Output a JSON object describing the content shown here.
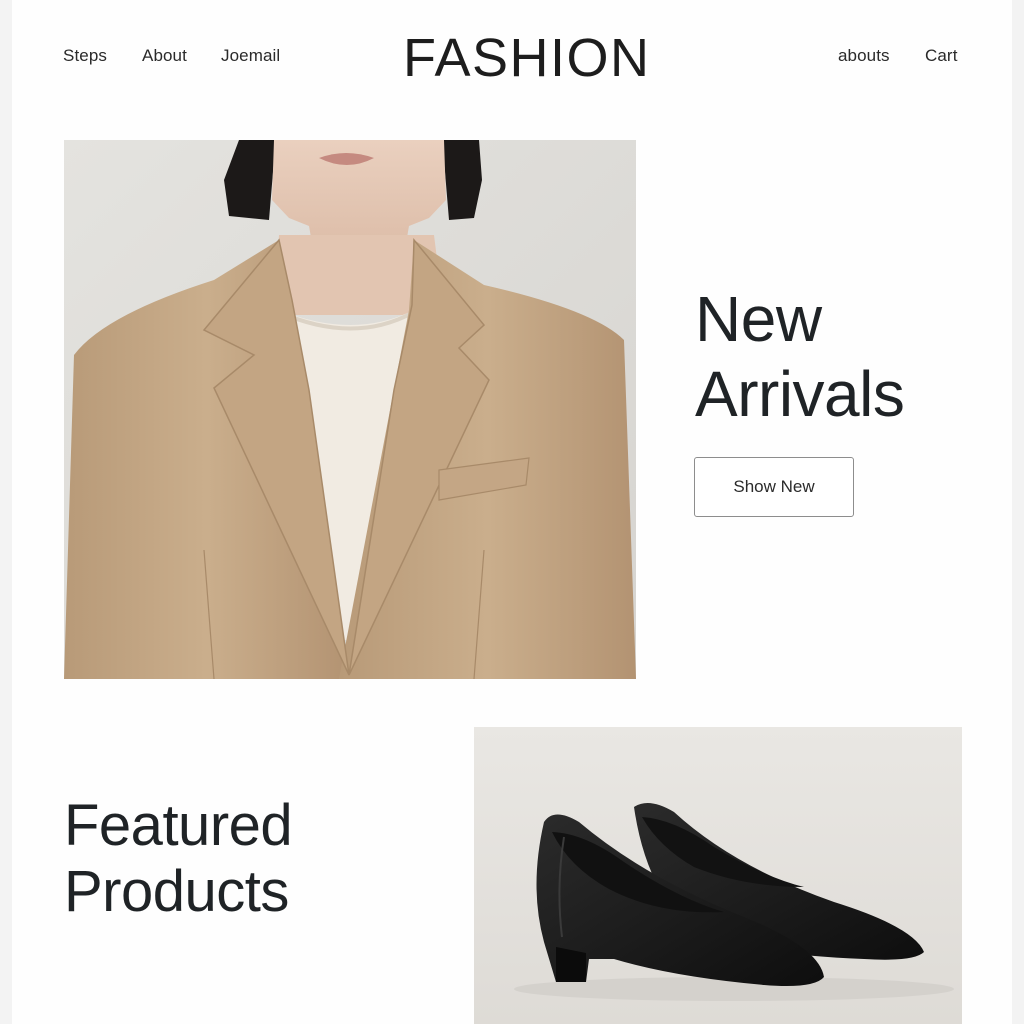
{
  "header": {
    "brand": "FASHION",
    "nav_left": [
      "Steps",
      "About",
      "Joemail"
    ],
    "nav_right": [
      "abouts",
      "Cart"
    ]
  },
  "hero": {
    "title_line1": "New",
    "title_line2": "Arrivals",
    "button_label": "Show New",
    "image": "model-wearing-camel-blazer"
  },
  "featured": {
    "title_line1": "Featured",
    "title_line2": "Products",
    "image": "black-leather-pumps"
  }
}
